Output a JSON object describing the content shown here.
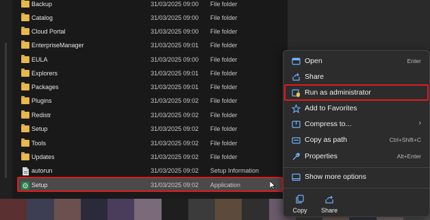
{
  "files": [
    {
      "name": "Backup",
      "date": "31/03/2025 09:00",
      "type": "File folder",
      "icon": "folder-icon"
    },
    {
      "name": "Catalog",
      "date": "31/03/2025 09:00",
      "type": "File folder",
      "icon": "folder-icon"
    },
    {
      "name": "Cloud Portal",
      "date": "31/03/2025 09:00",
      "type": "File folder",
      "icon": "folder-icon"
    },
    {
      "name": "EnterpriseManager",
      "date": "31/03/2025 09:01",
      "type": "File folder",
      "icon": "folder-icon"
    },
    {
      "name": "EULA",
      "date": "31/03/2025 09:00",
      "type": "File folder",
      "icon": "folder-icon"
    },
    {
      "name": "Explorers",
      "date": "31/03/2025 09:01",
      "type": "File folder",
      "icon": "folder-icon"
    },
    {
      "name": "Packages",
      "date": "31/03/2025 09:01",
      "type": "File folder",
      "icon": "folder-icon"
    },
    {
      "name": "Plugins",
      "date": "31/03/2025 09:02",
      "type": "File folder",
      "icon": "folder-icon"
    },
    {
      "name": "Redistr",
      "date": "31/03/2025 09:02",
      "type": "File folder",
      "icon": "folder-icon"
    },
    {
      "name": "Setup",
      "date": "31/03/2025 09:02",
      "type": "File folder",
      "icon": "folder-icon"
    },
    {
      "name": "Tools",
      "date": "31/03/2025 09:02",
      "type": "File folder",
      "icon": "folder-icon"
    },
    {
      "name": "Updates",
      "date": "31/03/2025 09:02",
      "type": "File folder",
      "icon": "folder-icon"
    },
    {
      "name": "autorun",
      "date": "31/03/2025 09:02",
      "type": "Setup Information",
      "icon": "document-icon"
    },
    {
      "name": "Setup",
      "date": "31/03/2025 09:02",
      "type": "Application",
      "icon": "application-icon",
      "selected": true
    }
  ],
  "context_menu": {
    "items": [
      {
        "label": "Open",
        "shortcut": "Enter",
        "icon": "open-icon"
      },
      {
        "label": "Share",
        "shortcut": "",
        "icon": "share-icon"
      },
      {
        "label": "Run as administrator",
        "shortcut": "",
        "icon": "shield-icon",
        "highlighted": true
      },
      {
        "label": "Add to Favorites",
        "shortcut": "",
        "icon": "star-icon"
      },
      {
        "label": "Compress to...",
        "shortcut": "",
        "icon": "zip-icon",
        "submenu": true
      },
      {
        "label": "Copy as path",
        "shortcut": "Ctrl+Shift+C",
        "icon": "path-icon"
      },
      {
        "label": "Properties",
        "shortcut": "Alt+Enter",
        "icon": "wrench-icon"
      },
      {
        "label": "Show more options",
        "shortcut": "",
        "icon": "more-options-icon"
      }
    ],
    "bottom_actions": [
      {
        "label": "Copy",
        "icon": "copy-icon"
      },
      {
        "label": "Share",
        "icon": "share-icon"
      }
    ]
  },
  "colors": {
    "highlight_border": "#e21b1b",
    "folder": "#e8b84a",
    "selected_row": "#4a4a4a",
    "menu_bg": "#2c2c2c",
    "accent_icon": "#6fb3ff"
  }
}
